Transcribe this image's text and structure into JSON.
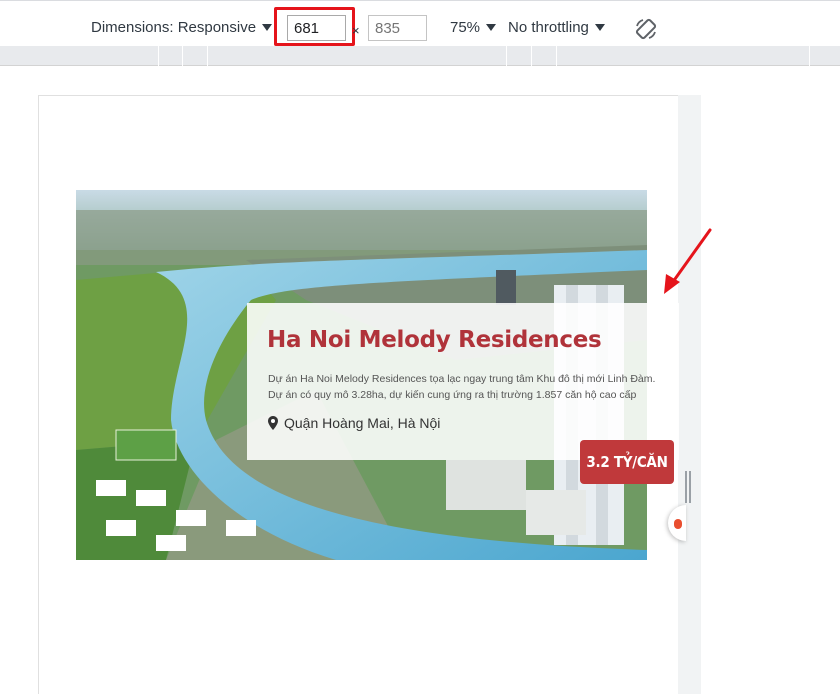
{
  "toolbar": {
    "dimensions_label": "Dimensions: Responsive",
    "width_value": "681",
    "times_symbol": "×",
    "height_placeholder": "835",
    "zoom_label": "75%",
    "throttling_label": "No throttling",
    "rotate_icon": "rotate-icon"
  },
  "hero": {
    "title": "Ha Noi Melody Residences",
    "description_line1": "Dự án Ha Noi Melody Residences tọa lạc ngay trung tâm Khu đô thị mới Linh Đàm.",
    "description_line2": "Dự án có quy mô 3.28ha, dự kiến cung ứng ra thị trường 1.857 căn hộ cao cấp",
    "location": "Quận Hoàng Mai, Hà Nội",
    "location_icon": "map-pin-icon",
    "price_badge": "3.2 TỶ/CĂN"
  },
  "colors": {
    "accent_red": "#b0333a",
    "badge_red": "#c0393b",
    "highlight_red": "#e5141b",
    "annotation_arrow": "#e5141b"
  }
}
